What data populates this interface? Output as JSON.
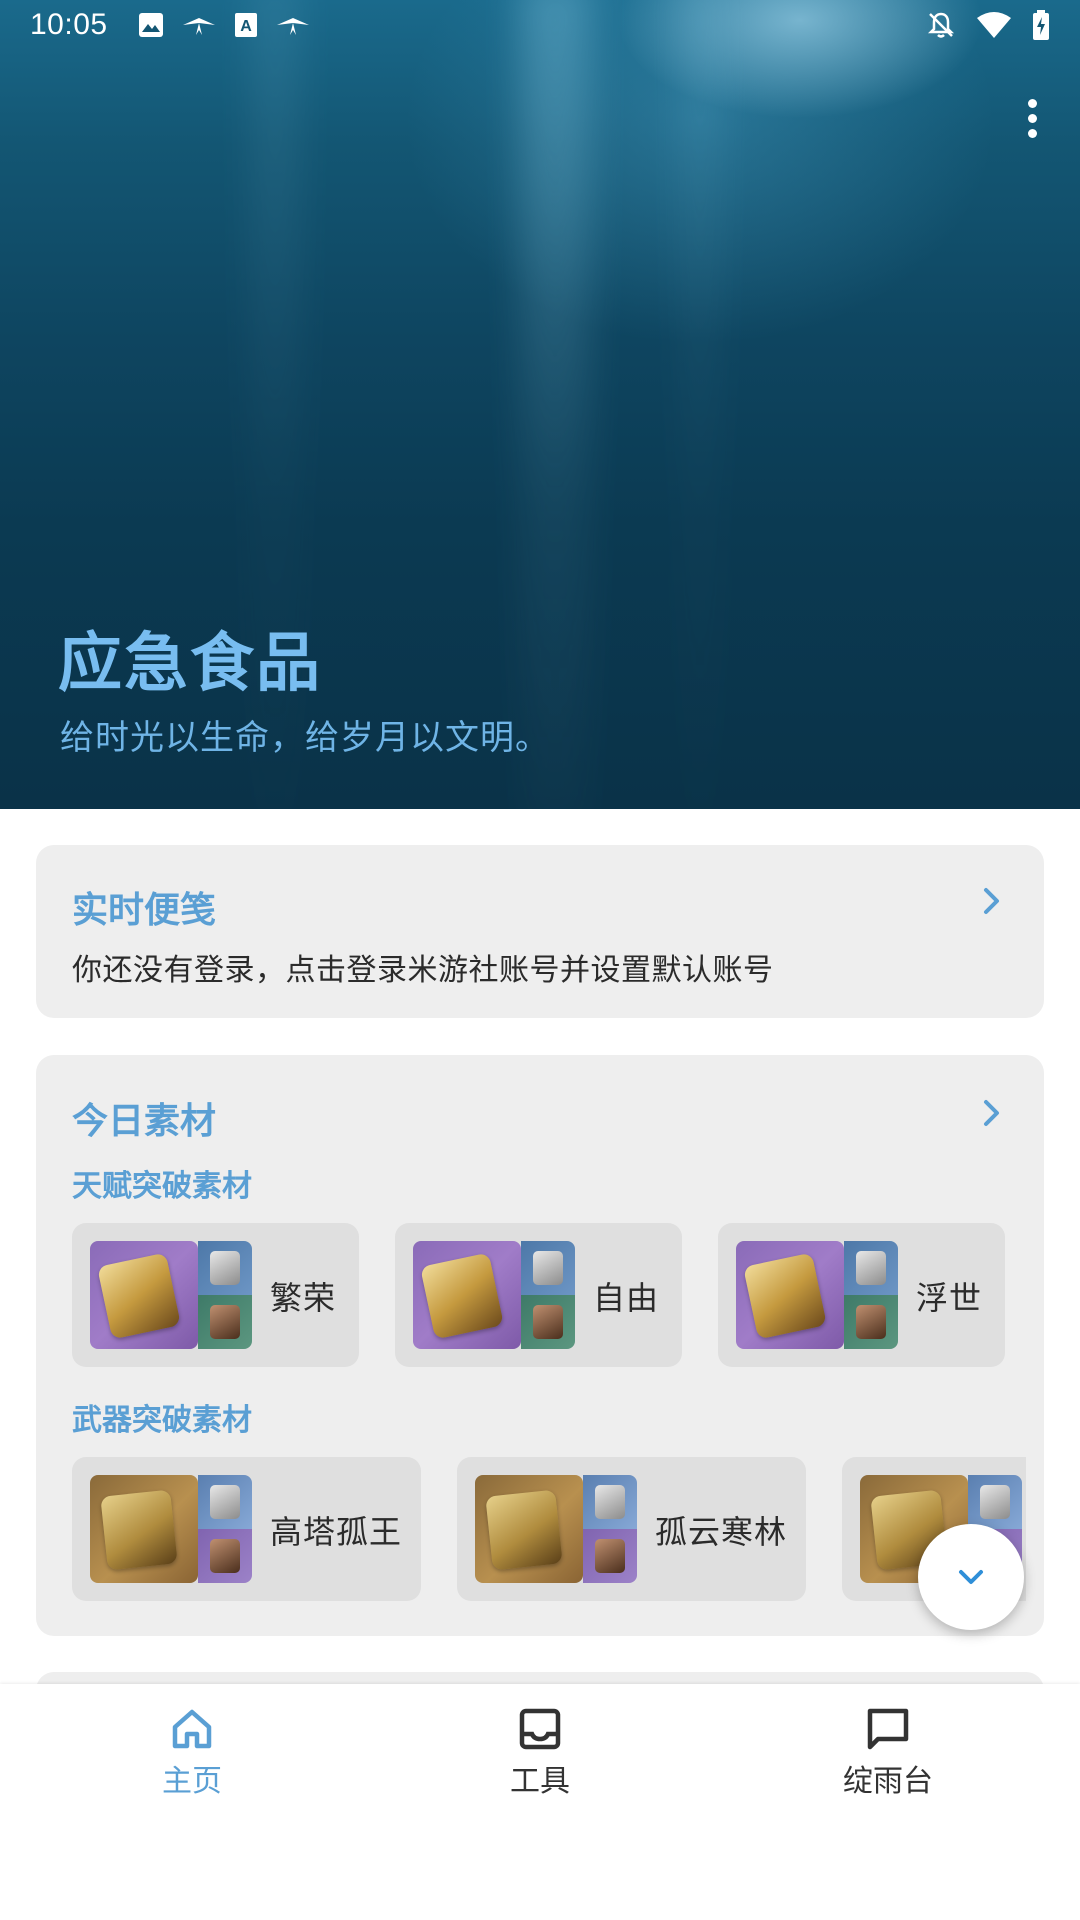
{
  "status_bar": {
    "time": "10:05",
    "left_icons": [
      "image-icon",
      "bird-icon",
      "a-box-icon",
      "bird-icon"
    ],
    "right_icons": [
      "bell-off-icon",
      "wifi-icon",
      "battery-icon"
    ]
  },
  "hero": {
    "title": "应急食品",
    "subtitle": "给时光以生命，给岁月以文明。"
  },
  "daily_note": {
    "title": "实时便笺",
    "message": "你还没有登录，点击登录米游社账号并设置默认账号"
  },
  "materials": {
    "title": "今日素材",
    "talent_label": "天赋突破素材",
    "talent_items": [
      {
        "name": "繁荣"
      },
      {
        "name": "自由"
      },
      {
        "name": "浮世"
      }
    ],
    "weapon_label": "武器突破素材",
    "weapon_items": [
      {
        "name": "高塔孤王"
      },
      {
        "name": "孤云寒林"
      },
      {
        "name": ""
      }
    ]
  },
  "bottom_nav": {
    "items": [
      {
        "label": "主页",
        "icon": "home-icon",
        "active": true
      },
      {
        "label": "工具",
        "icon": "inbox-icon",
        "active": false
      },
      {
        "label": "绽雨台",
        "icon": "chat-icon",
        "active": false
      }
    ]
  },
  "colors": {
    "accent": "#5a9fd4",
    "hero_title": "#78bdf0",
    "card_bg": "#eeeeee",
    "tile_bg": "#dfdfdf",
    "nav_inactive": "#333333"
  }
}
